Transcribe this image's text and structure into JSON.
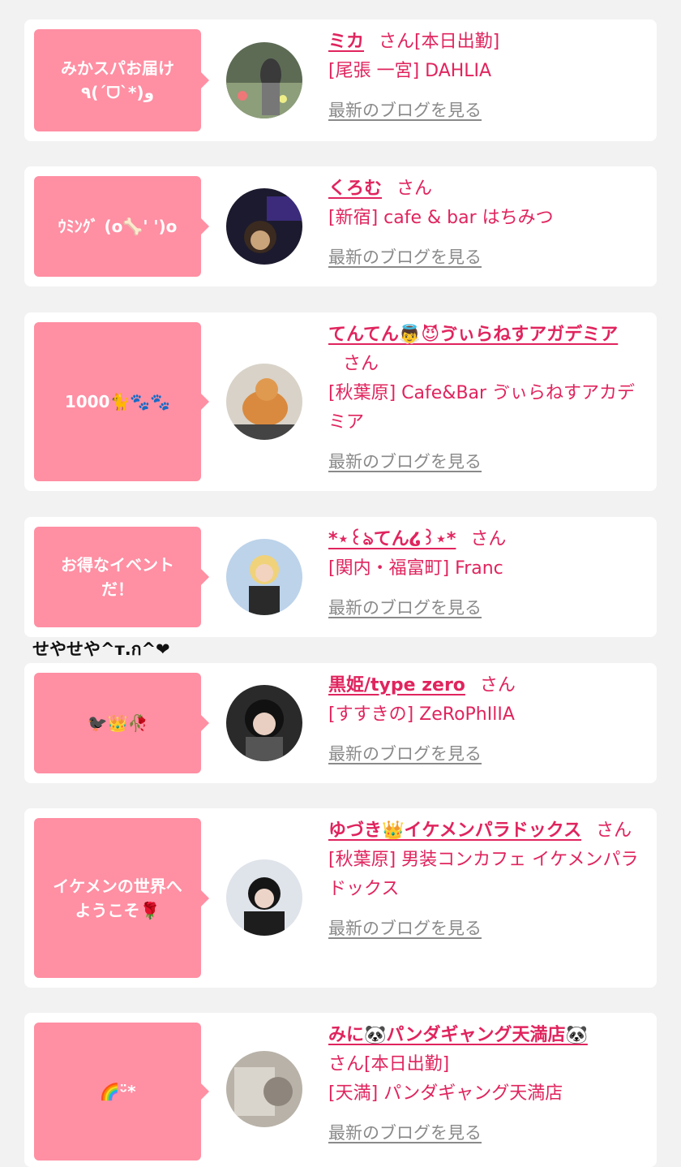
{
  "colors": {
    "background": "#f2f2f2",
    "card": "#ffffff",
    "bubble": "#ff8fa3",
    "accent": "#e0245e",
    "link_gray": "#8a8a8a"
  },
  "stray_text": "せやせや^т.ก^❤",
  "cards": [
    {
      "bubble": "みかスパお届け\n٩(ˊᗜˋ*)و",
      "name": "ミカ",
      "suffix": "さん[本日出勤]",
      "shop": "[尾張 一宮] DAHLIA",
      "blog_link": "最新のブログを見る"
    },
    {
      "bubble": "ｳﾐﾝｸﾞ (o🦴' ')o",
      "name": "くろむ",
      "suffix": "さん",
      "shop": "[新宿] cafe & bar はちみつ",
      "blog_link": "最新のブログを見る"
    },
    {
      "bubble": "1000🐈🐾🐾",
      "name": "てんてん👼😈ゔぃらねすアガデミア",
      "suffix": "さん",
      "shop": "[秋葉原] Cafe&Bar ゔぃらねすアカデミア",
      "blog_link": "最新のブログを見る"
    },
    {
      "bubble": "お得なイベント\nだ！",
      "name": "*⋆꒰ঌてん໒꒱⋆*",
      "suffix": "さん",
      "shop": "[関内・福富町] Franc",
      "blog_link": "最新のブログを見る"
    },
    {
      "bubble": "🐦‍⬛👑🥀",
      "name": "黒姫/type zero",
      "suffix": "さん",
      "shop": "[すすきの] ZeRoPhIlIA",
      "blog_link": "最新のブログを見る"
    },
    {
      "bubble": "イケメンの世界へ\nようこそ🌹",
      "name": "ゆづき👑イケメンパラドックス",
      "suffix": "さん",
      "shop": "[秋葉原] 男装コンカフェ イケメンパラドックス",
      "blog_link": "最新のブログを見る"
    },
    {
      "bubble": "🌈ᵕ̈*",
      "name": "みに🐼パンダギャング天満店🐼",
      "suffix": "さん[本日出勤]",
      "shop": "[天満] パンダギャング天満店",
      "blog_link": "最新のブログを見る"
    }
  ]
}
